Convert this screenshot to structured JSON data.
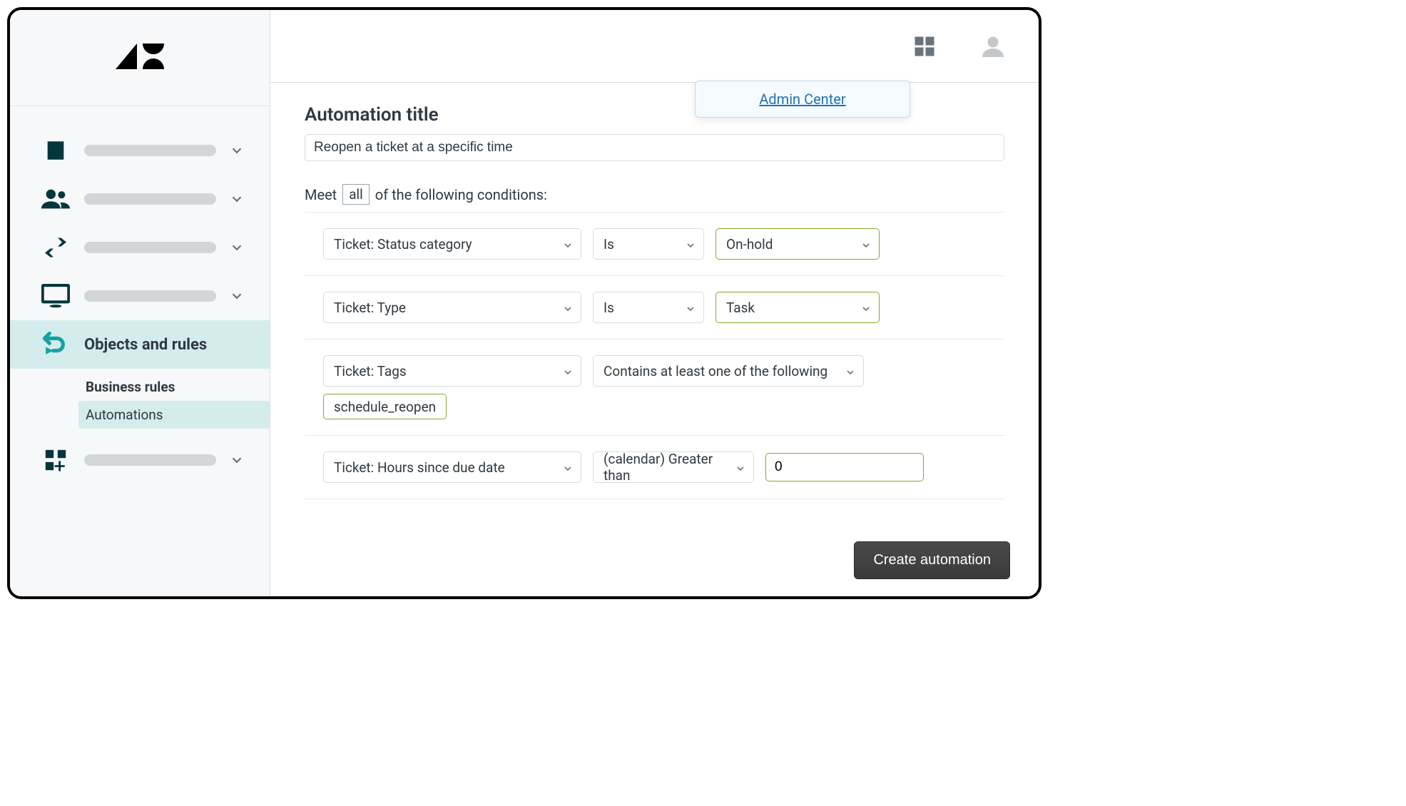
{
  "sidebar": {
    "objects_rules_label": "Objects and rules",
    "sub_business_rules": "Business rules",
    "sub_automations": "Automations"
  },
  "topbar": {
    "tooltip_link": "Admin Center"
  },
  "content": {
    "title_label": "Automation title",
    "title_value": "Reopen a ticket at a specific time",
    "meet_prefix": "Meet",
    "meet_all": "all",
    "meet_suffix": "of the following conditions:",
    "conditions": [
      {
        "field": "Ticket: Status category",
        "op": "Is",
        "value": "On-hold"
      },
      {
        "field": "Ticket: Type",
        "op": "Is",
        "value": "Task"
      },
      {
        "field": "Ticket: Tags",
        "op": "Contains at least one of the following",
        "tag": "schedule_reopen"
      },
      {
        "field": "Ticket: Hours since due date",
        "op": "(calendar) Greater than",
        "value": "0"
      }
    ],
    "create_btn": "Create automation"
  }
}
